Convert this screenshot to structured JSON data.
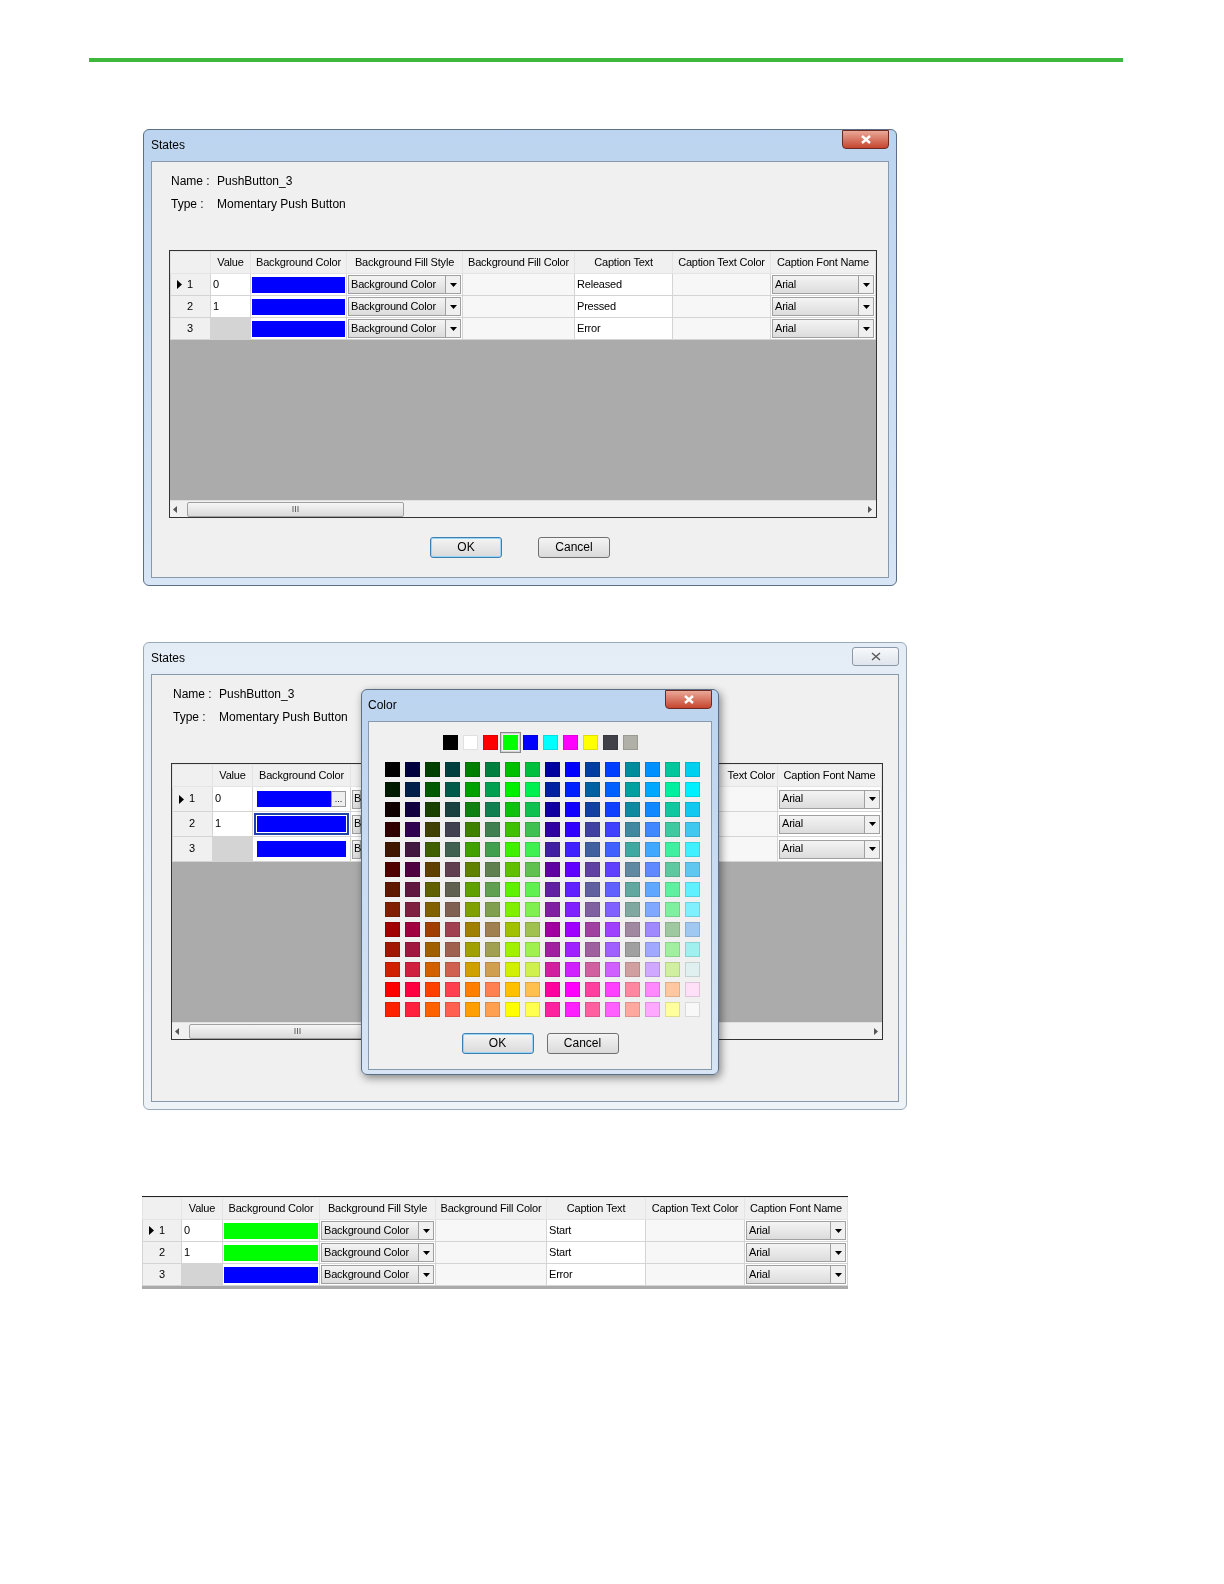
{
  "dialog_1": {
    "title": "States",
    "active": true,
    "name_label": "Name :",
    "name_value": "PushButton_3",
    "type_label": "Type :",
    "type_value": "Momentary Push Button",
    "table": {
      "columns": [
        "Value",
        "Background Color",
        "Background Fill Style",
        "Background Fill Color",
        "Caption Text",
        "Caption Text Color",
        "Caption Font Name"
      ],
      "rows": [
        {
          "row_header": "1",
          "current": true,
          "value": "0",
          "color": "#0000ff",
          "fill_style": "Background Color",
          "caption_text": "Released",
          "font_name": "Arial"
        },
        {
          "row_header": "2",
          "current": false,
          "value": "1",
          "color": "#0000ff",
          "fill_style": "Background Color",
          "caption_text": "Pressed",
          "font_name": "Arial"
        },
        {
          "row_header": "3",
          "current": false,
          "color": "#0000ff",
          "fill_style": "Background Color",
          "caption_text": "Error",
          "font_name": "Arial"
        }
      ]
    },
    "buttons": [
      {
        "label": "OK",
        "default": true
      },
      {
        "label": "Cancel",
        "default": false
      }
    ]
  },
  "dialog_2": {
    "title": "States",
    "active": false,
    "name_label": "Name :",
    "name_value": "PushButton_3",
    "type_label": "Type :",
    "type_value": "Momentary Push Button",
    "table": {
      "columns_left": [
        "Value",
        "Background Color"
      ],
      "columns_right": [
        "Text Color",
        "Caption Font Name"
      ],
      "rows": [
        {
          "row_header": "1",
          "current": true,
          "selected": false,
          "value": "0",
          "color": "#0000ff",
          "ellipsis": "...",
          "fill_style": "B",
          "font_name": "Arial"
        },
        {
          "row_header": "2",
          "current": false,
          "selected": true,
          "value": "1",
          "color": "#0000ff",
          "fill_style": "B",
          "font_name": "Arial"
        },
        {
          "row_header": "3",
          "current": false,
          "selected": false,
          "color": "#0000ff",
          "fill_style": "B",
          "font_name": "Arial"
        }
      ]
    },
    "color_dialog": {
      "title": "Color",
      "active": true,
      "basic_colors": [
        {
          "color": "#000000",
          "selected": false
        },
        {
          "color": "#ffffff",
          "selected": false
        },
        {
          "color": "#ff0000",
          "selected": false
        },
        {
          "color": "#00ff00",
          "selected": true
        },
        {
          "color": "#0000ff",
          "selected": false
        },
        {
          "color": "#00ffff",
          "selected": false
        },
        {
          "color": "#ff00ff",
          "selected": false
        },
        {
          "color": "#ffff00",
          "selected": false
        },
        {
          "color": "#404048",
          "selected": false
        },
        {
          "color": "#b0b0a8",
          "selected": false
        }
      ],
      "grid": [
        [
          {
            "color": "#000000"
          },
          {
            "color": "#00003f"
          },
          {
            "color": "#003f00"
          },
          {
            "color": "#003f3f"
          },
          {
            "color": "#007f00"
          },
          {
            "color": "#007f3f"
          },
          {
            "color": "#00bf00"
          },
          {
            "color": "#00bf3f"
          },
          {
            "color": "#00009f"
          },
          {
            "color": "#0000ff"
          },
          {
            "color": "#003f9f"
          },
          {
            "color": "#003fff"
          },
          {
            "color": "#008c9c"
          },
          {
            "color": "#0090ff"
          },
          {
            "color": "#00c89c"
          },
          {
            "color": "#00d0f0"
          }
        ],
        [
          {
            "color": "#001a00"
          },
          {
            "color": "#00204a"
          },
          {
            "color": "#005a00"
          },
          {
            "color": "#005a4a"
          },
          {
            "color": "#00a000"
          },
          {
            "color": "#00a050"
          },
          {
            "color": "#00f000"
          },
          {
            "color": "#00f050"
          },
          {
            "color": "#0020a0"
          },
          {
            "color": "#0020ff"
          },
          {
            "color": "#0060a0"
          },
          {
            "color": "#0060ff"
          },
          {
            "color": "#00a0a0"
          },
          {
            "color": "#00a8ff"
          },
          {
            "color": "#00f0a0"
          },
          {
            "color": "#00f0ff"
          }
        ],
        [
          {
            "color": "#100000"
          },
          {
            "color": "#100040"
          },
          {
            "color": "#1a4000"
          },
          {
            "color": "#1a4040"
          },
          {
            "color": "#108010"
          },
          {
            "color": "#108050"
          },
          {
            "color": "#10c010"
          },
          {
            "color": "#10c050"
          },
          {
            "color": "#1000a0"
          },
          {
            "color": "#1000ff"
          },
          {
            "color": "#1040a0"
          },
          {
            "color": "#1040ff"
          },
          {
            "color": "#1088a0"
          },
          {
            "color": "#1088ff"
          },
          {
            "color": "#10c8a0"
          },
          {
            "color": "#10c8f0"
          }
        ],
        [
          {
            "color": "#300000"
          },
          {
            "color": "#300050"
          },
          {
            "color": "#404000"
          },
          {
            "color": "#404050"
          },
          {
            "color": "#408000"
          },
          {
            "color": "#408050"
          },
          {
            "color": "#40c000"
          },
          {
            "color": "#40c050"
          },
          {
            "color": "#3000a0"
          },
          {
            "color": "#3000ff"
          },
          {
            "color": "#4040a0"
          },
          {
            "color": "#4040ff"
          },
          {
            "color": "#4088a0"
          },
          {
            "color": "#4088ff"
          },
          {
            "color": "#40c8a0"
          },
          {
            "color": "#40c8f0"
          }
        ],
        [
          {
            "color": "#401800"
          },
          {
            "color": "#401840"
          },
          {
            "color": "#406000"
          },
          {
            "color": "#406050"
          },
          {
            "color": "#40a000"
          },
          {
            "color": "#40a050"
          },
          {
            "color": "#40f000"
          },
          {
            "color": "#40f050"
          },
          {
            "color": "#4020a0"
          },
          {
            "color": "#4020ff"
          },
          {
            "color": "#4060a0"
          },
          {
            "color": "#4060ff"
          },
          {
            "color": "#40a8a0"
          },
          {
            "color": "#40a8ff"
          },
          {
            "color": "#40f0a0"
          },
          {
            "color": "#40f0ff"
          }
        ],
        [
          {
            "color": "#500000"
          },
          {
            "color": "#500040"
          },
          {
            "color": "#604000"
          },
          {
            "color": "#604050"
          },
          {
            "color": "#608000"
          },
          {
            "color": "#608050"
          },
          {
            "color": "#60c000"
          },
          {
            "color": "#60c050"
          },
          {
            "color": "#6000a0"
          },
          {
            "color": "#6000ff"
          },
          {
            "color": "#6040a0"
          },
          {
            "color": "#6040ff"
          },
          {
            "color": "#6088a0"
          },
          {
            "color": "#6088ff"
          },
          {
            "color": "#60c8a0"
          },
          {
            "color": "#60c8f0"
          }
        ],
        [
          {
            "color": "#601800"
          },
          {
            "color": "#601840"
          },
          {
            "color": "#606000"
          },
          {
            "color": "#606050"
          },
          {
            "color": "#60a000"
          },
          {
            "color": "#60a050"
          },
          {
            "color": "#60f000"
          },
          {
            "color": "#60f050"
          },
          {
            "color": "#6020a0"
          },
          {
            "color": "#6020ff"
          },
          {
            "color": "#6060a0"
          },
          {
            "color": "#6060ff"
          },
          {
            "color": "#60a8a0"
          },
          {
            "color": "#60a8ff"
          },
          {
            "color": "#60f0a0"
          },
          {
            "color": "#60f0ff"
          }
        ],
        [
          {
            "color": "#802000"
          },
          {
            "color": "#802040"
          },
          {
            "color": "#806000"
          },
          {
            "color": "#806050"
          },
          {
            "color": "#80a000"
          },
          {
            "color": "#80a050"
          },
          {
            "color": "#80f000"
          },
          {
            "color": "#80f050"
          },
          {
            "color": "#8020a0"
          },
          {
            "color": "#8020ff"
          },
          {
            "color": "#8060a0"
          },
          {
            "color": "#8060ff"
          },
          {
            "color": "#80a8a0"
          },
          {
            "color": "#80a8ff"
          },
          {
            "color": "#80f0a0"
          },
          {
            "color": "#80f0ff"
          }
        ],
        [
          {
            "color": "#a00000"
          },
          {
            "color": "#a00040"
          },
          {
            "color": "#a04000"
          },
          {
            "color": "#a04050"
          },
          {
            "color": "#a08000"
          },
          {
            "color": "#a08050"
          },
          {
            "color": "#a0c000"
          },
          {
            "color": "#a0c050"
          },
          {
            "color": "#a000a0"
          },
          {
            "color": "#a000ff"
          },
          {
            "color": "#a040a0"
          },
          {
            "color": "#a040ff"
          },
          {
            "color": "#a088a0"
          },
          {
            "color": "#a088ff"
          },
          {
            "color": "#a0c8a0"
          },
          {
            "color": "#a0c8f0"
          }
        ],
        [
          {
            "color": "#a01800"
          },
          {
            "color": "#a01840"
          },
          {
            "color": "#a06000"
          },
          {
            "color": "#a06050"
          },
          {
            "color": "#a0a000"
          },
          {
            "color": "#a0a050"
          },
          {
            "color": "#a0f000"
          },
          {
            "color": "#a0f050"
          },
          {
            "color": "#a020a0"
          },
          {
            "color": "#a020ff"
          },
          {
            "color": "#a060a0"
          },
          {
            "color": "#a060ff"
          },
          {
            "color": "#a0a0a0"
          },
          {
            "color": "#a0a8ff"
          },
          {
            "color": "#a0f0a0"
          },
          {
            "color": "#a0f0f0"
          }
        ],
        [
          {
            "color": "#d02000"
          },
          {
            "color": "#d02040"
          },
          {
            "color": "#d06000"
          },
          {
            "color": "#d06050"
          },
          {
            "color": "#d0a000"
          },
          {
            "color": "#d0a050"
          },
          {
            "color": "#d0f000"
          },
          {
            "color": "#d0f050"
          },
          {
            "color": "#d020a0"
          },
          {
            "color": "#d020ff"
          },
          {
            "color": "#d060a0"
          },
          {
            "color": "#d060ff"
          },
          {
            "color": "#d0a0a0"
          },
          {
            "color": "#d0a8ff"
          },
          {
            "color": "#d0f0a0"
          },
          {
            "color": "#e0f0f0"
          }
        ],
        [
          {
            "color": "#ff0000"
          },
          {
            "color": "#ff0040"
          },
          {
            "color": "#ff4000"
          },
          {
            "color": "#ff4050"
          },
          {
            "color": "#ff8000"
          },
          {
            "color": "#ff8050"
          },
          {
            "color": "#ffc000"
          },
          {
            "color": "#ffc050"
          },
          {
            "color": "#ff00a0"
          },
          {
            "color": "#ff00ff"
          },
          {
            "color": "#ff40a0"
          },
          {
            "color": "#ff40ff"
          },
          {
            "color": "#ff88a0"
          },
          {
            "color": "#ff88ff"
          },
          {
            "color": "#ffc8a0"
          },
          {
            "color": "#ffe0f8"
          }
        ],
        [
          {
            "color": "#ff2000"
          },
          {
            "color": "#ff2040"
          },
          {
            "color": "#ff6000"
          },
          {
            "color": "#ff6050"
          },
          {
            "color": "#ffa000"
          },
          {
            "color": "#ffa050"
          },
          {
            "color": "#ffff00"
          },
          {
            "color": "#ffff50"
          },
          {
            "color": "#ff20a0"
          },
          {
            "color": "#ff20ff"
          },
          {
            "color": "#ff60a0"
          },
          {
            "color": "#ff60ff"
          },
          {
            "color": "#ffa8a0"
          },
          {
            "color": "#ffa8ff"
          },
          {
            "color": "#ffffa0"
          },
          {
            "color": "#f8f8f8"
          }
        ]
      ],
      "buttons": [
        {
          "label": "OK",
          "default": true
        },
        {
          "label": "Cancel",
          "default": false
        }
      ]
    }
  },
  "table_3": {
    "columns": [
      "Value",
      "Background Color",
      "Background Fill Style",
      "Background Fill Color",
      "Caption Text",
      "Caption Text Color",
      "Caption Font Name"
    ],
    "rows": [
      {
        "row_header": "1",
        "current": true,
        "value": "0",
        "color": "#00ff00",
        "fill_style": "Background Color",
        "caption_text": "Start",
        "font_name": "Arial"
      },
      {
        "row_header": "2",
        "current": false,
        "value": "1",
        "color": "#00ff00",
        "fill_style": "Background Color",
        "caption_text": "Start",
        "font_name": "Arial"
      },
      {
        "row_header": "3",
        "current": false,
        "color": "#0000ff",
        "fill_style": "Background Color",
        "caption_text": "Error",
        "font_name": "Arial"
      }
    ]
  }
}
